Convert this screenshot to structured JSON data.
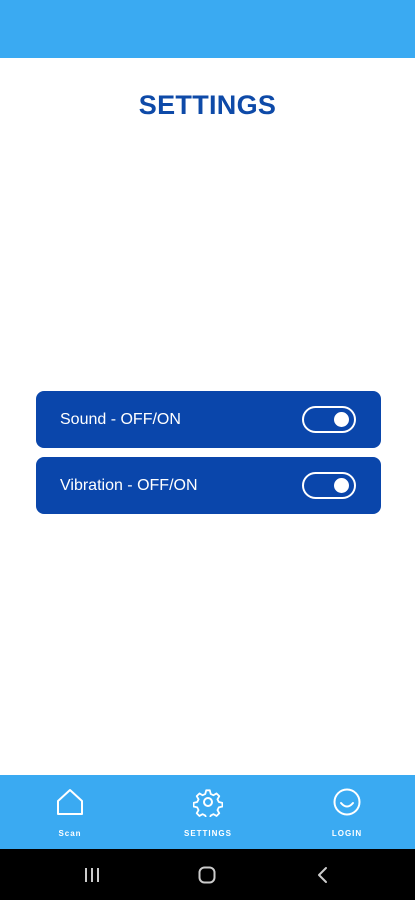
{
  "page": {
    "title": "SETTINGS"
  },
  "settings": [
    {
      "label": "Sound - OFF/ON",
      "enabled": true
    },
    {
      "label": "Vibration - OFF/ON",
      "enabled": true
    }
  ],
  "bottom_nav": [
    {
      "label": "Scan",
      "icon": "home-icon"
    },
    {
      "label": "SETTINGS",
      "icon": "gear-icon"
    },
    {
      "label": "LOGIN",
      "icon": "smiley-icon"
    }
  ],
  "system_nav": {
    "recent_icon": "recent-apps-icon",
    "home_icon": "system-home-icon",
    "back_icon": "back-icon"
  },
  "colors": {
    "accent": "#3aaaf2",
    "primary": "#0a46ab",
    "title": "#0e4aa8"
  }
}
